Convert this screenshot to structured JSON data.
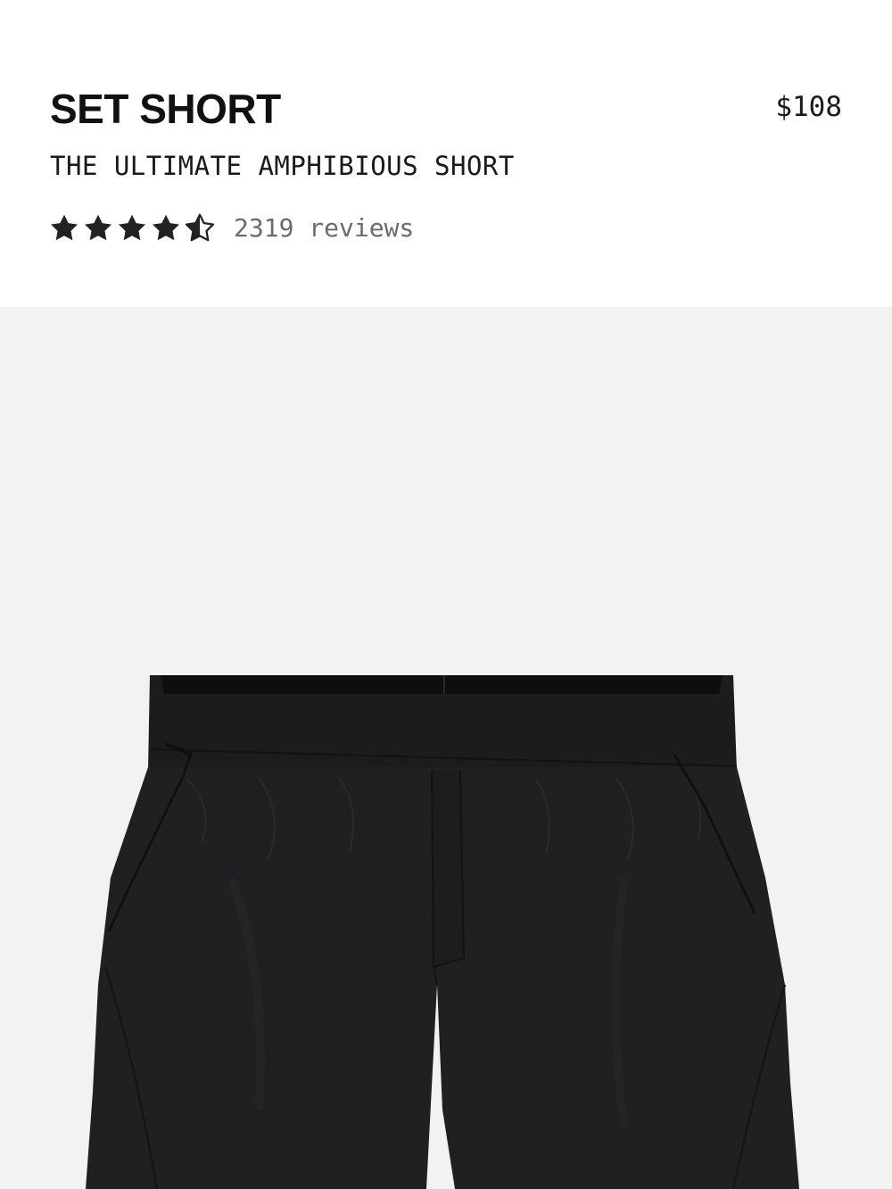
{
  "product": {
    "title": "SET SHORT",
    "price": "$108",
    "subtitle": "THE ULTIMATE AMPHIBIOUS SHORT",
    "rating": 4.5,
    "rating_max": 5,
    "reviews_label": "2319 reviews"
  },
  "media": {
    "image_subject": "black-shorts",
    "background_color": "#f2f2f2"
  },
  "colors": {
    "star": "#222222",
    "review_text": "#6b6b6b",
    "shorts": "#1f2021"
  }
}
